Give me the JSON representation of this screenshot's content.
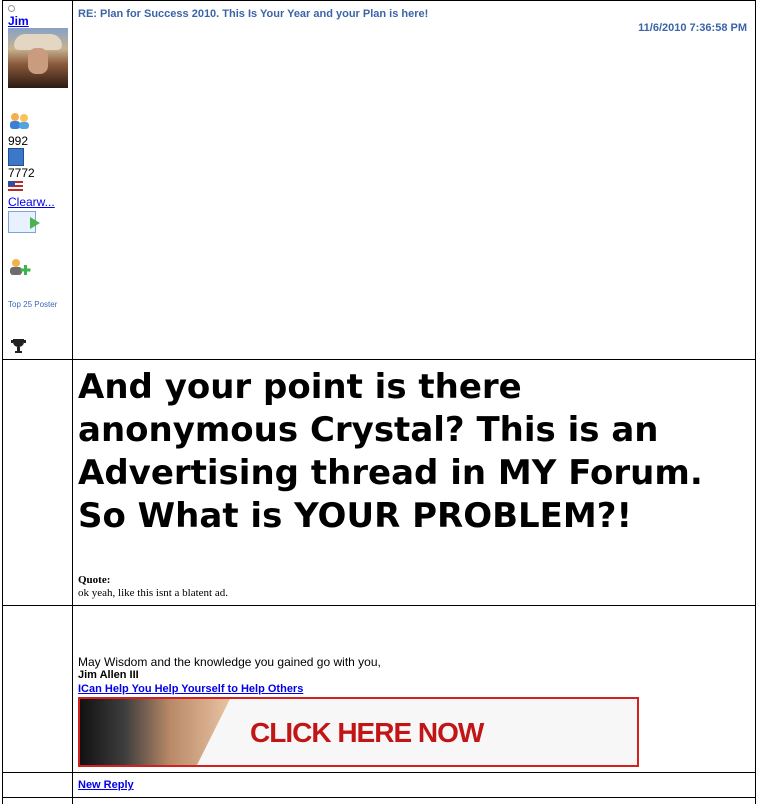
{
  "author": {
    "name": "Jim",
    "friends_count": "992",
    "posts_count": "7772",
    "location": "Clearw...",
    "badge_text": "Top 25 Poster"
  },
  "post": {
    "title": "RE: Plan for Success 2010. This Is Your Year and your Plan is here!",
    "date": "11/6/2010 7:36:58 PM",
    "headline": "And your point is there anonymous Crystal? This is an Advertising thread in MY Forum. So What is YOUR PROBLEM?!",
    "quote_label": "Quote:",
    "quote_text": "ok yeah, like this isnt a blatent ad."
  },
  "signature": {
    "line1": "May Wisdom and the knowledge you gained go with you,",
    "name": "Jim Allen III",
    "link": "ICan Help You Help Yourself to Help Others",
    "banner_text": "CLICK HERE NOW"
  },
  "actions": {
    "new_reply": "New Reply"
  },
  "icons": {
    "friends": "friends-icon",
    "posts": "posts-icon",
    "flag": "us-flag-icon",
    "mail": "mail-icon",
    "add_friend": "add-friend-icon",
    "trophy": "trophy-icon"
  }
}
